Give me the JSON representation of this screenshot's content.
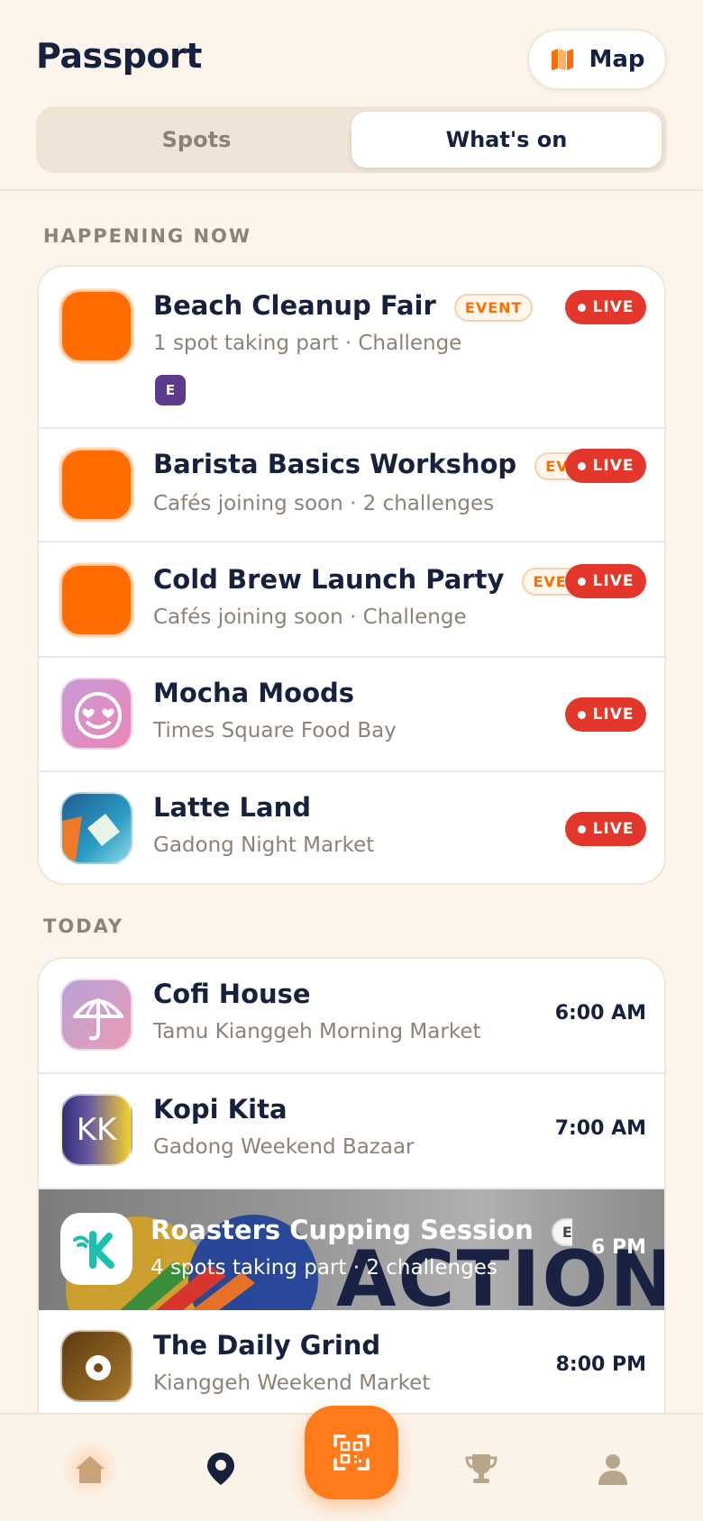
{
  "header": {
    "title": "Passport",
    "map_button": {
      "label": "Map",
      "icon": "map-icon"
    },
    "tabs": [
      {
        "label": "Spots",
        "active": false
      },
      {
        "label": "What's on",
        "active": true
      }
    ]
  },
  "sections": {
    "happening_now": {
      "label": "HAPPENING NOW",
      "items": [
        {
          "title": "Beach Cleanup Fair",
          "tag": "EVENT",
          "subtitle": "1 spot taking part · Challenge",
          "status": "LIVE",
          "badge": "E"
        },
        {
          "title": "Barista Basics Workshop",
          "tag": "EVENT",
          "subtitle": "Cafés joining soon · 2 challenges",
          "status": "LIVE"
        },
        {
          "title": "Cold Brew Launch Party",
          "tag": "EVENT",
          "subtitle": "Cafés joining soon · Challenge",
          "status": "LIVE"
        },
        {
          "title": "Mocha Moods",
          "subtitle": "Times Square Food Bay",
          "status": "LIVE"
        },
        {
          "title": "Latte Land",
          "subtitle": "Gadong Night Market",
          "status": "LIVE"
        }
      ]
    },
    "today": {
      "label": "TODAY",
      "items": [
        {
          "title": "Cofi House",
          "subtitle": "Tamu Kianggeh Morning Market",
          "time": "6:00 AM",
          "thumb_text": ""
        },
        {
          "title": "Kopi Kita",
          "subtitle": "Gadong Weekend Bazaar",
          "time": "7:00 AM",
          "thumb_text": "KK"
        },
        {
          "title": "Roasters Cupping Session",
          "tag": "EVENT",
          "subtitle": "4 spots taking part · 2 challenges",
          "time": "6 PM",
          "banner_text": "ACTION"
        },
        {
          "title": "The Daily Grind",
          "subtitle": "Kianggeh Weekend Market",
          "time": "8:00 PM"
        }
      ]
    }
  },
  "bottom_nav": {
    "items": [
      "home-icon",
      "location-pin-icon",
      "qr-scan-icon",
      "trophy-icon",
      "profile-icon"
    ],
    "active": "home-icon"
  },
  "colors": {
    "background": "#fdf5ec",
    "accent": "#ff6d00",
    "live": "#e4372b",
    "text": "#16213e",
    "muted": "#8b8278"
  }
}
